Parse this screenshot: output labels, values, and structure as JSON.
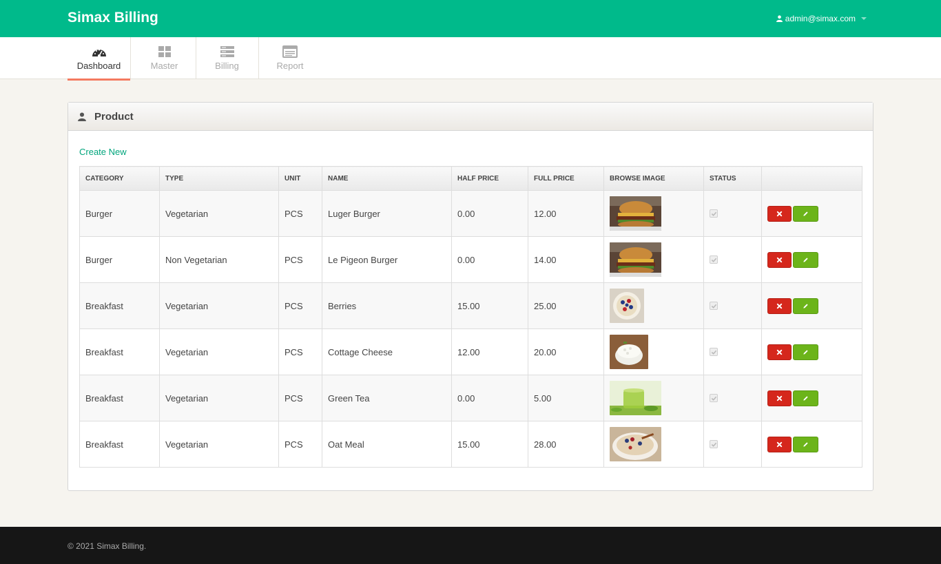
{
  "header": {
    "brand": "Simax Billing",
    "user_email": "admin@simax.com"
  },
  "nav": {
    "items": [
      {
        "label": "Dashboard",
        "icon": "dashboard-icon"
      },
      {
        "label": "Master",
        "icon": "grid-icon"
      },
      {
        "label": "Billing",
        "icon": "list-icon"
      },
      {
        "label": "Report",
        "icon": "report-icon"
      }
    ],
    "active_index": 0
  },
  "panel": {
    "title": "Product",
    "create_new": "Create New"
  },
  "table": {
    "columns": [
      "CATEGORY",
      "TYPE",
      "UNIT",
      "NAME",
      "HALF PRICE",
      "FULL PRICE",
      "BROWSE IMAGE",
      "STATUS",
      ""
    ],
    "rows": [
      {
        "category": "Burger",
        "type": "Vegetarian",
        "unit": "PCS",
        "name": "Luger Burger",
        "half_price": "0.00",
        "full_price": "12.00",
        "image": "burger-image",
        "status": true
      },
      {
        "category": "Burger",
        "type": "Non Vegetarian",
        "unit": "PCS",
        "name": "Le Pigeon Burger",
        "half_price": "0.00",
        "full_price": "14.00",
        "image": "burger-image",
        "status": true
      },
      {
        "category": "Breakfast",
        "type": "Vegetarian",
        "unit": "PCS",
        "name": "Berries",
        "half_price": "15.00",
        "full_price": "25.00",
        "image": "berries-bowl-image",
        "status": true
      },
      {
        "category": "Breakfast",
        "type": "Vegetarian",
        "unit": "PCS",
        "name": "Cottage Cheese",
        "half_price": "12.00",
        "full_price": "20.00",
        "image": "cottage-cheese-image",
        "status": true
      },
      {
        "category": "Breakfast",
        "type": "Vegetarian",
        "unit": "PCS",
        "name": "Green Tea",
        "half_price": "0.00",
        "full_price": "5.00",
        "image": "green-tea-image",
        "status": true
      },
      {
        "category": "Breakfast",
        "type": "Vegetarian",
        "unit": "PCS",
        "name": "Oat Meal",
        "half_price": "15.00",
        "full_price": "28.00",
        "image": "oat-meal-image",
        "status": true
      }
    ]
  },
  "footer": {
    "text": "© 2021 Simax Billing."
  },
  "colors": {
    "brand": "#00ba8b",
    "active_tab_underline": "#f47a60",
    "delete_button": "#d5271c",
    "edit_button": "#6cb41a"
  }
}
